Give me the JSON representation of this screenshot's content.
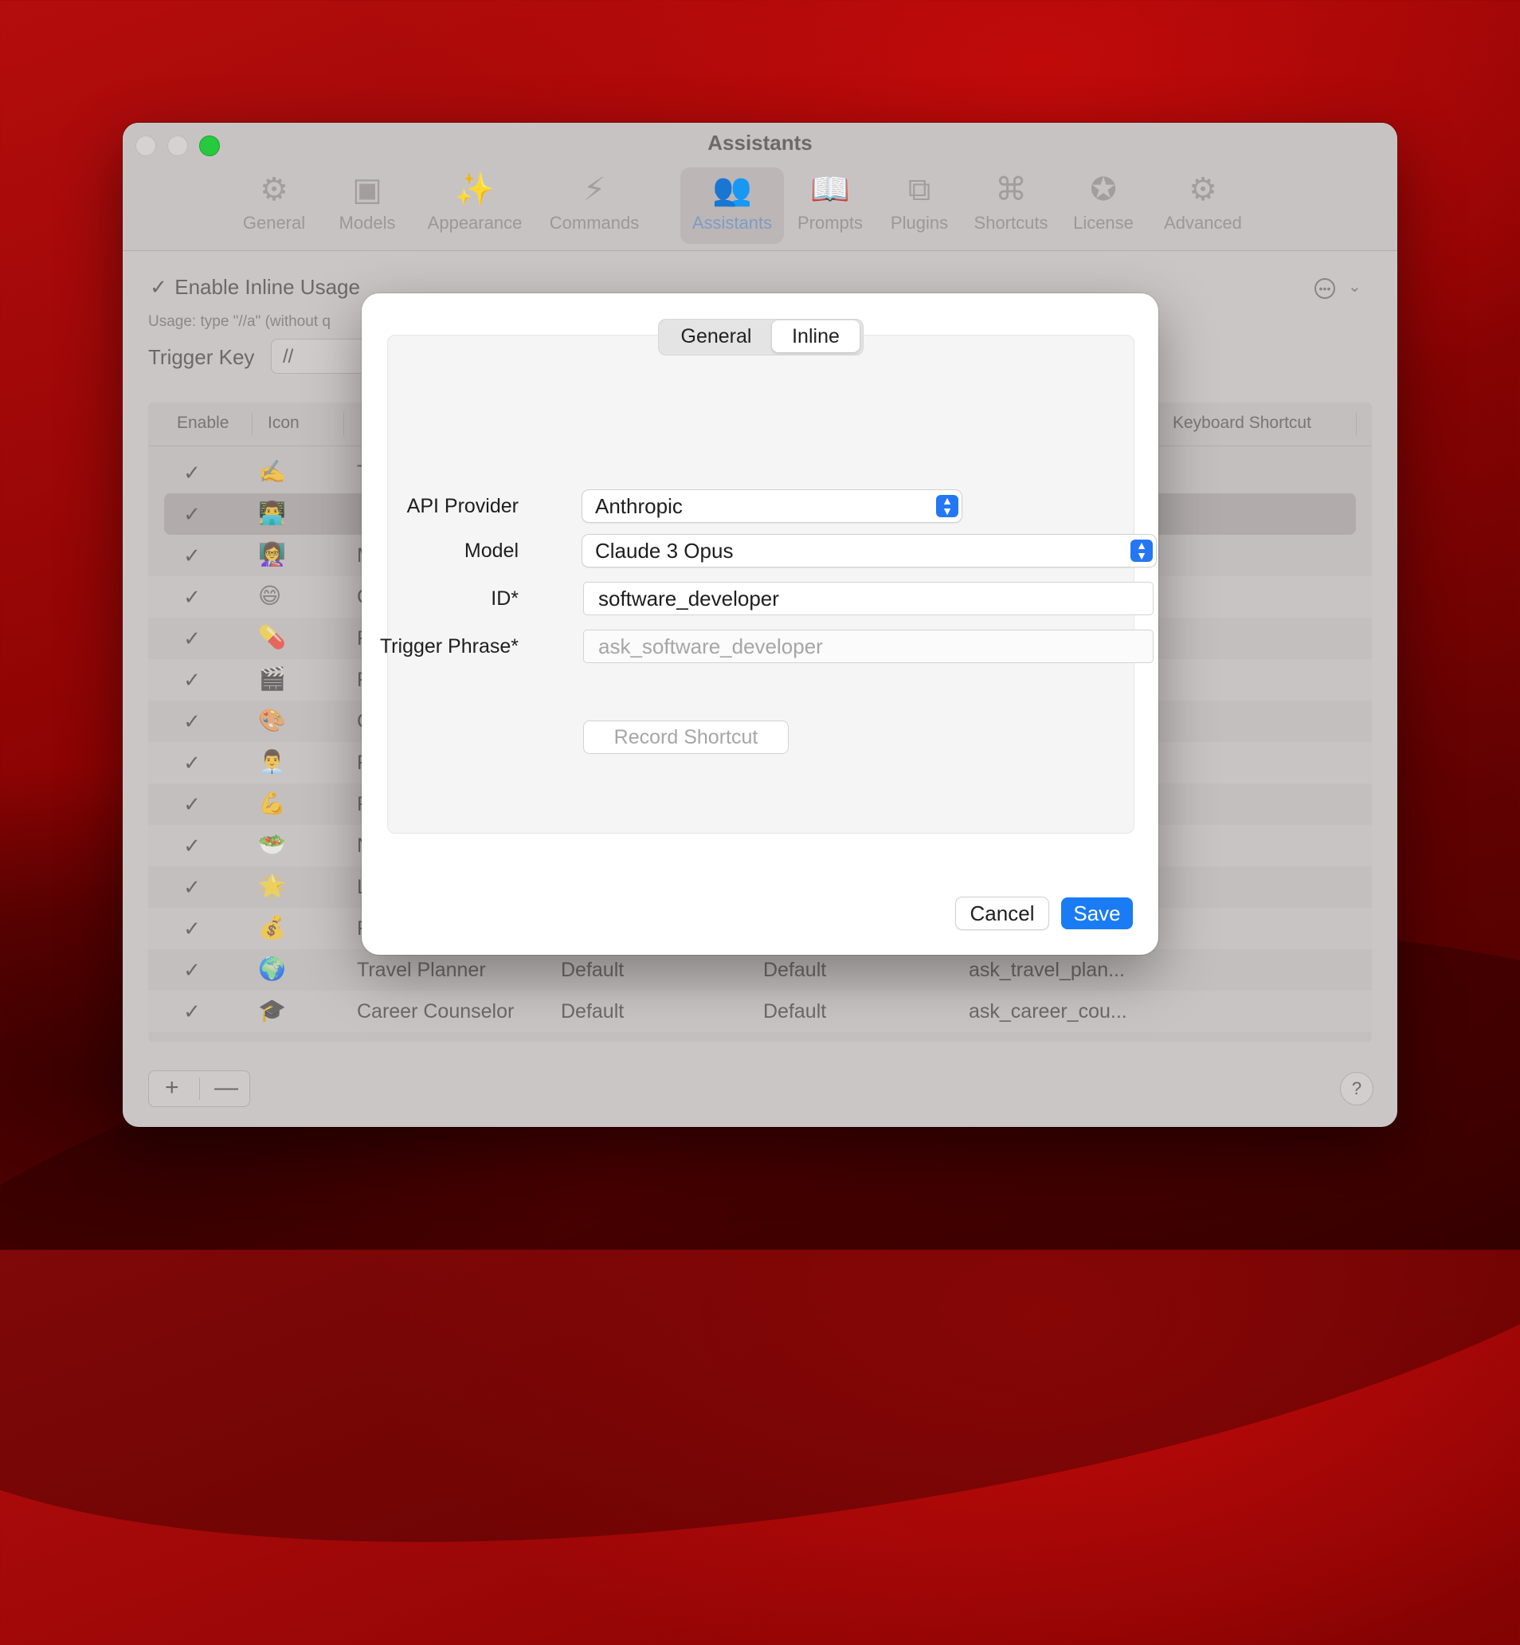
{
  "window": {
    "title": "Assistants"
  },
  "toolbar": {
    "items": [
      {
        "label": "General",
        "icon": "gear-icon",
        "glyph": "⚙"
      },
      {
        "label": "Models",
        "icon": "chip-icon",
        "glyph": "▣"
      },
      {
        "label": "Appearance",
        "icon": "magic-wand-icon",
        "glyph": "✨"
      },
      {
        "label": "Commands",
        "icon": "bolt-icon",
        "glyph": "⚡"
      },
      {
        "label": "Assistants",
        "icon": "people-icon",
        "glyph": "👥"
      },
      {
        "label": "Prompts",
        "icon": "book-icon",
        "glyph": "📖"
      },
      {
        "label": "Plugins",
        "icon": "puzzle-icon",
        "glyph": "⧉"
      },
      {
        "label": "Shortcuts",
        "icon": "command-key-icon",
        "glyph": "⌘"
      },
      {
        "label": "License",
        "icon": "seal-check-icon",
        "glyph": "✪"
      },
      {
        "label": "Advanced",
        "icon": "gears-icon",
        "glyph": "⚙"
      }
    ],
    "active": "Assistants"
  },
  "settings": {
    "enable_inline_label": "Enable Inline Usage",
    "enable_inline_checked": true,
    "usage_text": "Usage: type \"//a\" (without q",
    "trigger_key_label": "Trigger Key",
    "trigger_key_value": "//"
  },
  "table": {
    "headers": {
      "enable": "Enable",
      "icon": "Icon",
      "keyboard_shortcut": "Keyboard Shortcut"
    },
    "rows": [
      {
        "icon": "✍️",
        "name": "T",
        "provider": "",
        "model": "",
        "trigger": "",
        "enabled": true
      },
      {
        "icon": "👨‍💻",
        "name": "S",
        "provider": "",
        "model": "",
        "trigger": "",
        "enabled": true,
        "selected": true
      },
      {
        "icon": "👩‍🏫",
        "name": "M",
        "provider": "",
        "model": "",
        "trigger": "",
        "enabled": true
      },
      {
        "icon": "😄",
        "name": "C",
        "provider": "",
        "model": "",
        "trigger": "",
        "enabled": true
      },
      {
        "icon": "💊",
        "name": "F",
        "provider": "",
        "model": "",
        "trigger": "",
        "enabled": true
      },
      {
        "icon": "🎬",
        "name": "F",
        "provider": "",
        "model": "",
        "trigger": "",
        "enabled": true
      },
      {
        "icon": "🎨",
        "name": "C",
        "provider": "",
        "model": "",
        "trigger": "",
        "enabled": true
      },
      {
        "icon": "👨‍💼",
        "name": "F",
        "provider": "",
        "model": "",
        "trigger": "",
        "enabled": true
      },
      {
        "icon": "💪",
        "name": "F",
        "provider": "",
        "model": "",
        "trigger": "",
        "enabled": true
      },
      {
        "icon": "🥗",
        "name": "N",
        "provider": "",
        "model": "",
        "trigger": "",
        "enabled": true
      },
      {
        "icon": "🌟",
        "name": "L",
        "provider": "",
        "model": "",
        "trigger": "",
        "enabled": true
      },
      {
        "icon": "💰",
        "name": "F",
        "provider": "",
        "model": "",
        "trigger": "",
        "enabled": true
      },
      {
        "icon": "🌍",
        "name": "Travel Planner",
        "provider": "Default",
        "model": "Default",
        "trigger": "ask_travel_plan...",
        "enabled": true
      },
      {
        "icon": "🎓",
        "name": "Career Counselor",
        "provider": "Default",
        "model": "Default",
        "trigger": "ask_career_cou...",
        "enabled": true
      }
    ]
  },
  "footer": {
    "add_label": "+",
    "remove_label": "—",
    "help_label": "?"
  },
  "dialog": {
    "tabs": [
      "General",
      "Inline"
    ],
    "active_tab": "Inline",
    "fields": {
      "api_provider_label": "API Provider",
      "api_provider_value": "Anthropic",
      "model_label": "Model",
      "model_value": "Claude 3 Opus",
      "id_label": "ID*",
      "id_value": "software_developer",
      "trigger_phrase_label": "Trigger Phrase*",
      "trigger_phrase_placeholder": "ask_software_developer",
      "record_shortcut_label": "Record Shortcut"
    },
    "cancel_label": "Cancel",
    "save_label": "Save"
  },
  "colors": {
    "accent": "#1a7cf4",
    "traffic_green": "#27c93f"
  }
}
